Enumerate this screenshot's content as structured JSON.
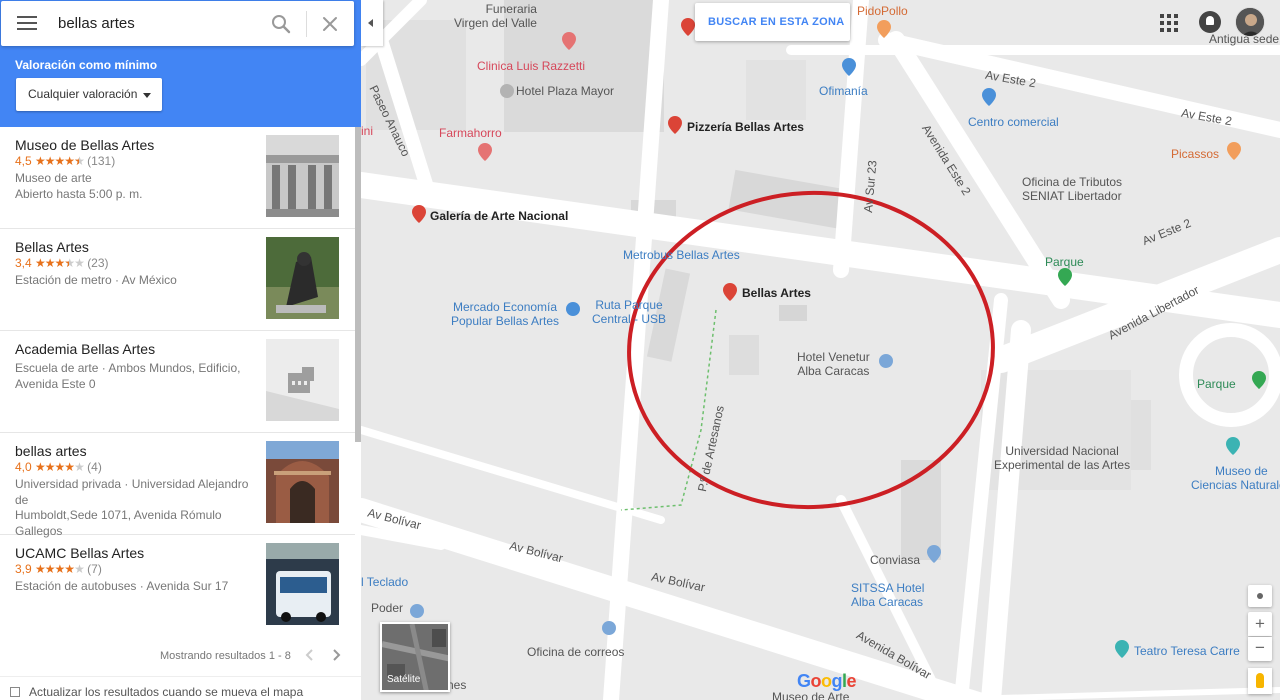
{
  "search": {
    "query": "bellas artes",
    "menu_icon": "menu-icon",
    "search_icon": "search-icon",
    "close_icon": "close-icon"
  },
  "filter": {
    "label": "Valoración como mínimo",
    "dropdown_value": "Cualquier valoración"
  },
  "results": [
    {
      "name": "Museo de Bellas Artes",
      "rating": "4,5",
      "stars": 4.5,
      "reviews": "(131)",
      "lines": [
        "Museo de arte",
        "Abierto hasta 5:00 p. m."
      ]
    },
    {
      "name": "Bellas Artes",
      "rating": "3,4",
      "stars": 3.5,
      "reviews": "(23)",
      "lines": [
        "Estación de metro · Av México"
      ]
    },
    {
      "name": "Academia Bellas Artes",
      "rating": "",
      "stars": 0,
      "reviews": "",
      "lines": [
        "Escuela de arte · Ambos Mundos, Edificio,",
        "Avenida Este 0"
      ]
    },
    {
      "name": "bellas artes",
      "rating": "4,0",
      "stars": 4,
      "reviews": "(4)",
      "lines": [
        "Universidad privada · Universidad Alejandro de",
        "Humboldt,Sede 1071, Avenida Rómulo",
        "Gallegos"
      ]
    },
    {
      "name": "UCAMC Bellas Artes",
      "rating": "3,9",
      "stars": 4,
      "reviews": "(7)",
      "lines": [
        "Estación de autobuses · Avenida Sur 17"
      ]
    }
  ],
  "pagination": {
    "text": "Mostrando resultados 1 - 8"
  },
  "update_on_move": {
    "label": "Actualizar los resultados cuando se mueva el mapa",
    "checked": false
  },
  "map": {
    "search_zone_button": "BUSCAR EN ESTA ZONA",
    "satellite_label": "Satélite",
    "zoom_in": "+",
    "zoom_out": "−",
    "logo": "Google",
    "labels": {
      "funeraria": [
        "Funeraria",
        "Virgen del Valle"
      ],
      "pidopollo": "PidoPollo",
      "clinica": "Clinica Luis Razzetti",
      "hotel_plaza": "Hotel Plaza Mayor",
      "ofimania": "Ofimanía",
      "antigua_ctv": "Antigua sede CTV",
      "pizzeria": "Pizzería Bellas Artes",
      "farmahorro": "Farmahorro",
      "centro_comercial": "Centro comercial",
      "picassos": "Picassos",
      "oficina_tributos": [
        "Oficina de Tributos",
        "SENIAT Libertador"
      ],
      "galeria": "Galería de Arte Nacional",
      "metrobus": "Metrobus Bellas Artes",
      "parque1": "Parque",
      "bellas_artes_pin": "Bellas Artes",
      "mercado": [
        "Mercado Economía",
        "Popular Bellas Artes"
      ],
      "ruta_parque": [
        "Ruta Parque",
        "Central - USB"
      ],
      "hotel_venetur": [
        "Hotel Venetur",
        "Alba Caracas"
      ],
      "parque2": "Parque",
      "universidad": [
        "Universidad Nacional",
        "Experimental de las Artes"
      ],
      "museo_ciencias": [
        "Museo de",
        "Ciencias Naturales"
      ],
      "conviasa": "Conviasa",
      "teclado": "l Teclado",
      "sitssa": [
        "SITSSA Hotel",
        "Alba Caracas"
      ],
      "poder": "Poder",
      "correos": "Oficina de correos",
      "teatro": "Teatro Teresa Carre",
      "museo_arte_bottom": "Museo de Arte",
      "nes": "nes",
      "ini": "ini"
    },
    "streets": {
      "paseo_anauco": "Paseo Anauco",
      "av_este2_a": "Av Este 2",
      "av_este2_b": "Av Este 2",
      "avenida_este2": "Avenida Este 2",
      "av_este2_c": "Av Este 2",
      "av_sur23": "Av Sur 23",
      "avenida_libertador": "Avenida Libertador",
      "paseo_artesanos": "P.º de Artesanos",
      "av_bolivar_1": "Av Bolívar",
      "av_bolivar_2": "Av Bolívar",
      "av_bolivar_3": "Av Bolívar",
      "avenida_bolivar": "Avenida Bolívar"
    },
    "annotation_color": "#cc1f24",
    "icons": [
      "apps-icon",
      "notifications-icon",
      "avatar",
      "my-location-icon",
      "pegman-icon"
    ]
  }
}
